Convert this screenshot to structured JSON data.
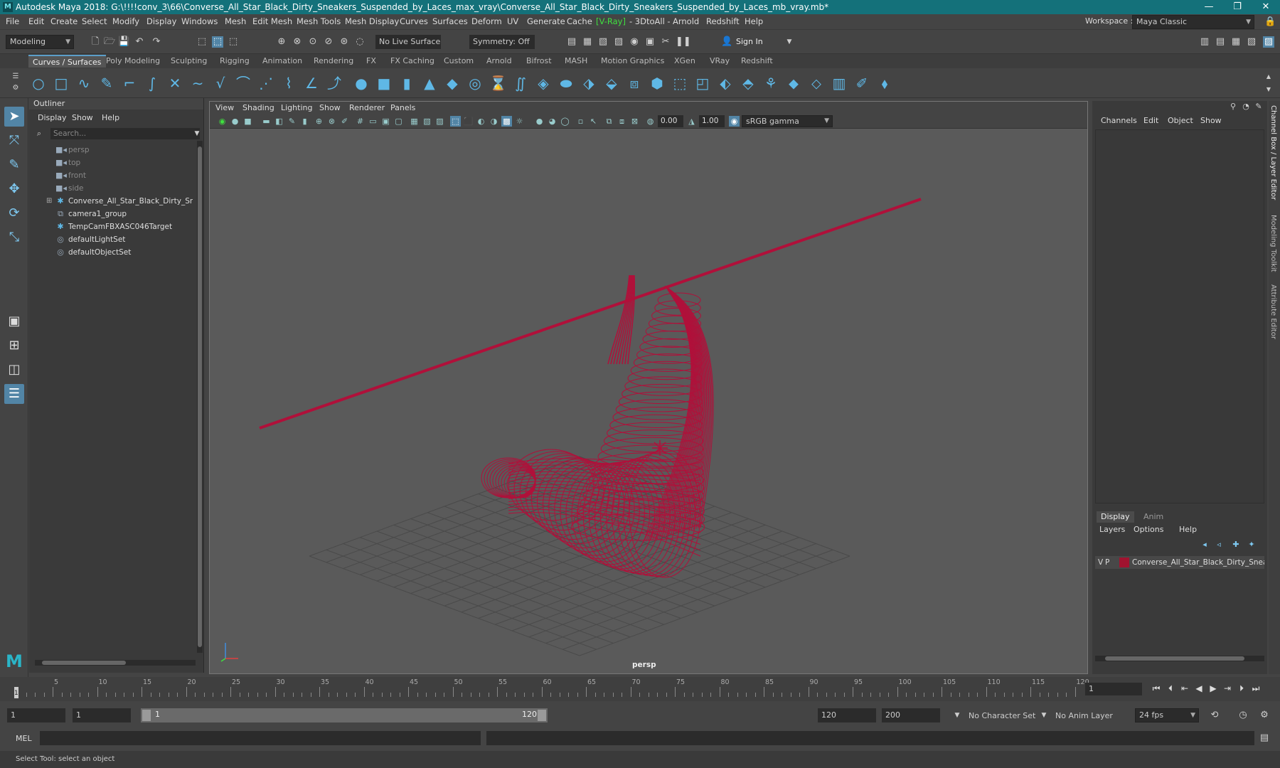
{
  "window": {
    "title": "Autodesk Maya 2018: G:\\!!!!conv_3\\66\\Converse_All_Star_Black_Dirty_Sneakers_Suspended_by_Laces_max_vray\\Converse_All_Star_Black_Dirty_Sneakers_Suspended_by_Laces_mb_vray.mb*",
    "minimize": "—",
    "maximize": "❐",
    "close": "✕"
  },
  "menubar": {
    "items": [
      "File",
      "Edit",
      "Create",
      "Select",
      "Modify",
      "Display",
      "Windows",
      "Mesh",
      "Edit Mesh",
      "Mesh Tools",
      "Mesh Display",
      "Curves",
      "Surfaces",
      "Deform",
      "UV",
      "Generate",
      "Cache",
      "V-Ray",
      "- 3DtoAll -",
      "Arnold",
      "Redshift",
      "Help"
    ],
    "workspace_label": "Workspace :",
    "workspace_value": "Maya Classic"
  },
  "statusline": {
    "mode": "Modeling",
    "live_surface": "No Live Surface",
    "symmetry": "Symmetry: Off",
    "sign_in": "Sign In"
  },
  "shelf": {
    "tabs": [
      "Curves / Surfaces",
      "Poly Modeling",
      "Sculpting",
      "Rigging",
      "Animation",
      "Rendering",
      "FX",
      "FX Caching",
      "Custom",
      "Arnold",
      "Bifrost",
      "MASH",
      "Motion Graphics",
      "XGen",
      "VRay",
      "Redshift"
    ],
    "active_tab": "Curves / Surfaces"
  },
  "outliner": {
    "title": "Outliner",
    "menus": [
      "Display",
      "Show",
      "Help"
    ],
    "search_placeholder": "Search...",
    "items": [
      {
        "label": "persp",
        "icon": "camera-icon",
        "dim": true
      },
      {
        "label": "top",
        "icon": "camera-icon",
        "dim": true
      },
      {
        "label": "front",
        "icon": "camera-icon",
        "dim": true
      },
      {
        "label": "side",
        "icon": "camera-icon",
        "dim": true
      },
      {
        "label": "Converse_All_Star_Black_Dirty_Sneakers",
        "icon": "locator-icon",
        "dim": false
      },
      {
        "label": "camera1_group",
        "icon": "group-icon",
        "dim": false
      },
      {
        "label": "TempCamFBXASC046Target",
        "icon": "locator-icon",
        "dim": false
      },
      {
        "label": "defaultLightSet",
        "icon": "set-icon",
        "dim": false
      },
      {
        "label": "defaultObjectSet",
        "icon": "set-icon",
        "dim": false
      }
    ]
  },
  "viewport": {
    "menus": [
      "View",
      "Shading",
      "Lighting",
      "Show",
      "Renderer",
      "Panels"
    ],
    "exposure": "0.00",
    "gamma": "1.00",
    "color_space": "sRGB gamma",
    "camera_label": "persp",
    "wire_color": "#b0103a"
  },
  "channelbox": {
    "menus": [
      "Channels",
      "Edit",
      "Object",
      "Show"
    ],
    "layer_tabs": [
      "Display",
      "Anim"
    ],
    "layer_menus": [
      "Layers",
      "Options",
      "Help"
    ],
    "layer": {
      "v": "V",
      "p": "P",
      "name": "Converse_All_Star_Black_Dirty_Sneakers",
      "color": "#a0132f"
    },
    "side_tabs": [
      "Channel Box / Layer Editor",
      "Modeling Toolkit",
      "Attribute Editor"
    ]
  },
  "timeslider": {
    "ticks": [
      "5",
      "10",
      "15",
      "20",
      "25",
      "30",
      "35",
      "40",
      "45",
      "50",
      "55",
      "60",
      "65",
      "70",
      "75",
      "80",
      "85",
      "90",
      "95",
      "100",
      "105",
      "110",
      "115",
      "120"
    ],
    "current_frame_marker": "1",
    "current_frame": "1"
  },
  "rangebar": {
    "start": "1",
    "playback_start": "1",
    "range_start": "1",
    "range_end": "120",
    "playback_end": "120",
    "end": "200",
    "character_set": "No Character Set",
    "anim_layer": "No Anim Layer",
    "fps": "24 fps"
  },
  "cmdline": {
    "label": "MEL"
  },
  "helpline": {
    "text": "Select Tool: select an object"
  }
}
